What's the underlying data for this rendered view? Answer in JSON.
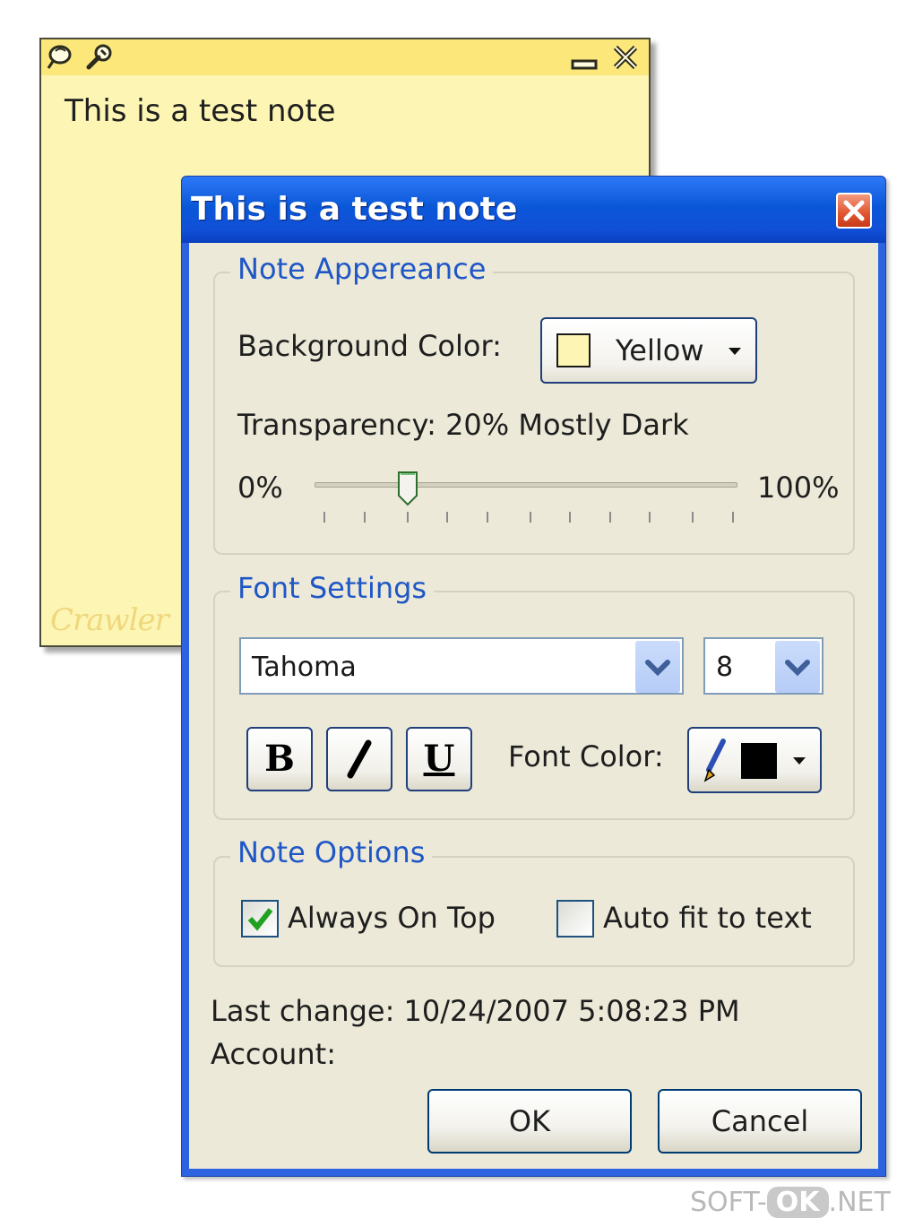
{
  "note": {
    "text": "This is a test note",
    "logo": "Crawler",
    "icons": [
      "pin-icon",
      "wrench-icon",
      "minimize-icon",
      "close-icon"
    ],
    "background": "#fdf5b4"
  },
  "dialog": {
    "title": "This is a test note",
    "close_icon": "close-icon",
    "appearance": {
      "legend": "Note Appereance",
      "bg_label": "Background Color:",
      "bg_value": "Yellow",
      "transparency_label": "Transparency: 20% Mostly Dark",
      "min_label": "0%",
      "max_label": "100%",
      "slider_value_percent": 20
    },
    "font": {
      "legend": "Font Settings",
      "family": "Tahoma",
      "size": "8",
      "bold_label": "B",
      "italic_label": "I",
      "underline_label": "U",
      "color_label": "Font Color:",
      "color_value": "#000000"
    },
    "options": {
      "legend": "Note Options",
      "always_on_top": {
        "label": "Always On Top",
        "checked": true
      },
      "auto_fit": {
        "label": "Auto fit to text",
        "checked": false
      }
    },
    "last_change": "Last change: 10/24/2007 5:08:23 PM",
    "account": "Account:",
    "ok_label": "OK",
    "cancel_label": "Cancel"
  },
  "watermark": {
    "prefix": "SOFT-",
    "ok": "OK",
    "suffix": ".NET"
  }
}
